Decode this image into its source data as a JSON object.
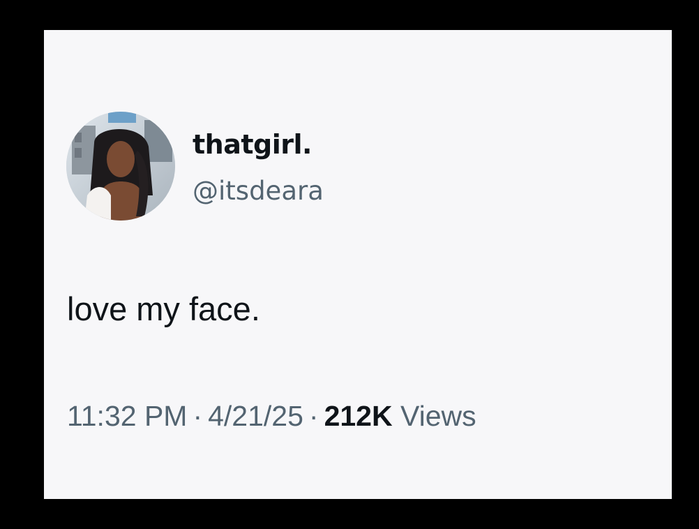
{
  "tweet": {
    "author": {
      "display_name": "thatgirl.",
      "handle": "@itsdeara"
    },
    "text": "love my face.",
    "meta": {
      "time": "11:32 PM",
      "separator": "·",
      "date": "4/21/25",
      "views_count": "212K",
      "views_label": "Views"
    }
  },
  "colors": {
    "background": "#000000",
    "card": "#f7f7f9",
    "primary_text": "#0f1419",
    "secondary_text": "#536471"
  },
  "icons": {
    "avatar": "profile-photo"
  }
}
